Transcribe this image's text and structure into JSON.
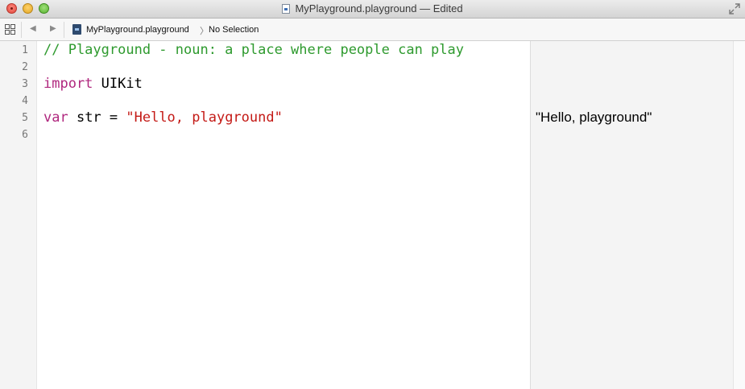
{
  "window": {
    "title": "MyPlayground.playground — Edited"
  },
  "jumpbar": {
    "file": "MyPlayground.playground",
    "selection": "No Selection"
  },
  "editor": {
    "line_numbers": [
      "1",
      "2",
      "3",
      "4",
      "5",
      "6"
    ],
    "lines": {
      "l1_comment": "// Playground - noun: a place where people can play",
      "l3_keyword": "import",
      "l3_rest": " UIKit",
      "l5_keyword": "var",
      "l5_rest": " str = ",
      "l5_string": "\"Hello, playground\""
    }
  },
  "results": {
    "line5": "\"Hello, playground\""
  },
  "colors": {
    "comment": "#2e9a2e",
    "keyword": "#b0277e",
    "string": "#c41a16"
  },
  "icons": {
    "close": "close-traffic-light",
    "minimize": "minimize-traffic-light",
    "zoom": "zoom-traffic-light",
    "fullscreen": "fullscreen-arrows-icon",
    "grid": "related-items-grid-icon",
    "back": "back-arrow-icon",
    "forward": "forward-arrow-icon",
    "file": "playground-file-icon",
    "chevron": "breadcrumb-chevron-icon"
  }
}
